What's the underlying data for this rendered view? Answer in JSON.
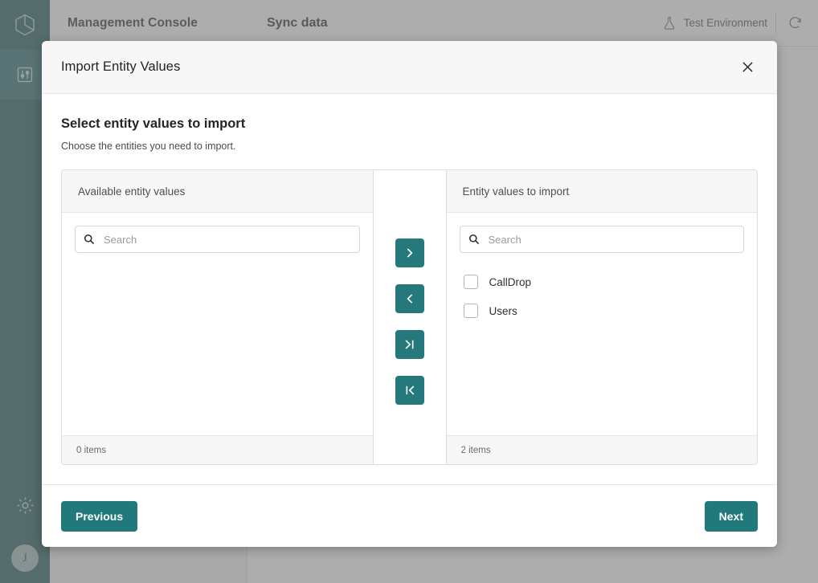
{
  "app": {
    "console_title": "Management Console",
    "page_title": "Sync data",
    "environment_label": "Test Environment",
    "avatar_initial": "J",
    "accent_color": "#22797b",
    "rail_color": "#1a5456"
  },
  "modal": {
    "title": "Import Entity Values",
    "close_label": "×",
    "section_title": "Select entity values to import",
    "section_subtitle": "Choose the entities you need to import."
  },
  "picklist": {
    "source": {
      "header": "Available entity values",
      "search_placeholder": "Search",
      "search_value": "",
      "items": [],
      "count_label": "0 items"
    },
    "target": {
      "header": "Entity values to import",
      "search_placeholder": "Search",
      "search_value": "",
      "items": [
        {
          "label": "CallDrop",
          "checked": false
        },
        {
          "label": "Users",
          "checked": false
        }
      ],
      "count_label": "2 items"
    },
    "controls": [
      {
        "name": "move-right",
        "glyph": "›"
      },
      {
        "name": "move-left",
        "glyph": "‹"
      },
      {
        "name": "move-all-right",
        "glyph": "›|"
      },
      {
        "name": "move-all-left",
        "glyph": "|‹"
      }
    ]
  },
  "footer": {
    "previous_label": "Previous",
    "next_label": "Next"
  }
}
